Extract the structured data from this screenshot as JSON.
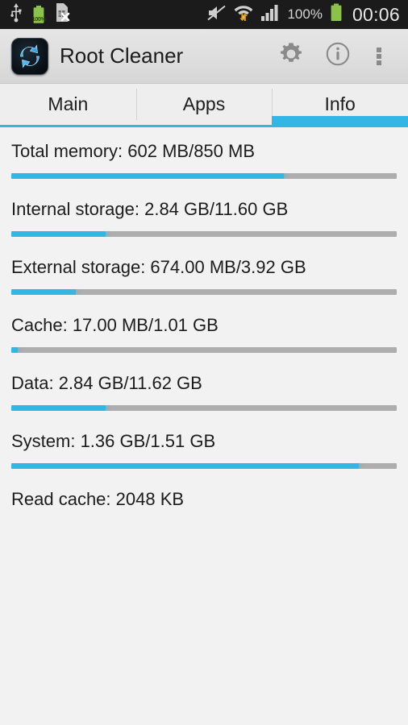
{
  "status_bar": {
    "left_icons": [
      "usb-icon",
      "battery-icon",
      "no-sim-card-icon"
    ],
    "battery_label": "100%",
    "right_icons": [
      "mute-icon",
      "wifi-icon",
      "signal-icon"
    ],
    "battery_percent": "100%",
    "clock": "00:06"
  },
  "action_bar": {
    "app_icon": "root-cleaner-refresh-icon",
    "title": "Root Cleaner",
    "actions": [
      {
        "name": "settings-button",
        "icon": "gear-icon"
      },
      {
        "name": "info-button",
        "icon": "info-circle-icon"
      },
      {
        "name": "overflow-button",
        "icon": "more-vertical-icon"
      }
    ]
  },
  "tabs": {
    "items": [
      {
        "label": "Main",
        "selected": false
      },
      {
        "label": "Apps",
        "selected": false
      },
      {
        "label": "Info",
        "selected": true
      }
    ],
    "accent_color": "#33b5e5"
  },
  "info": {
    "rows": [
      {
        "label": "Total memory: 602 MB/850 MB",
        "percent": 70.8,
        "has_bar": true
      },
      {
        "label": "Internal storage: 2.84 GB/11.60 GB",
        "percent": 24.5,
        "has_bar": true
      },
      {
        "label": "External storage: 674.00 MB/3.92 GB",
        "percent": 16.8,
        "has_bar": true
      },
      {
        "label": "Cache: 17.00 MB/1.01 GB",
        "percent": 1.6,
        "has_bar": true
      },
      {
        "label": "Data: 2.84 GB/11.62 GB",
        "percent": 24.4,
        "has_bar": true
      },
      {
        "label": "System: 1.36 GB/1.51 GB",
        "percent": 90.1,
        "has_bar": true
      },
      {
        "label": "Read cache: 2048 KB",
        "percent": 0,
        "has_bar": false
      }
    ]
  },
  "colors": {
    "accent": "#33b5e5",
    "track": "#adadad",
    "background": "#f2f2f2",
    "statusbar": "#1b1b1b",
    "battery_green": "#8bc34a"
  }
}
